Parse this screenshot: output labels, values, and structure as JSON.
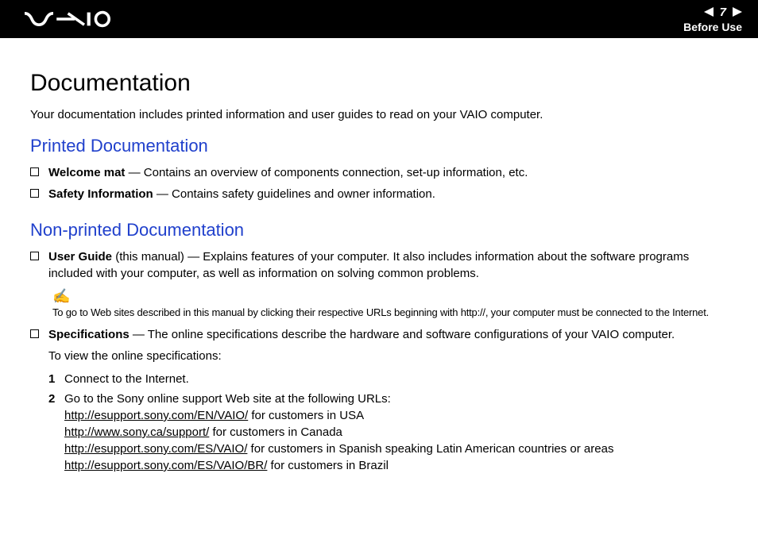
{
  "header": {
    "page_number": "7",
    "section": "Before Use"
  },
  "title": "Documentation",
  "intro": "Your documentation includes printed information and user guides to read on your VAIO computer.",
  "printed": {
    "heading": "Printed Documentation",
    "items": [
      {
        "label": "Welcome mat",
        "desc": " — Contains an overview of components connection, set-up information, etc."
      },
      {
        "label": "Safety Information",
        "desc": " — Contains safety guidelines and owner information."
      }
    ]
  },
  "nonprinted": {
    "heading": "Non-printed Documentation",
    "user_guide": {
      "label": "User Guide",
      "suffix": " (this manual) — Explains features of your computer. It also includes information about the software programs included with your computer, as well as information on solving common problems."
    },
    "note": "To go to Web sites described in this manual by clicking their respective URLs beginning with http://, your computer must be connected to the Internet.",
    "specs": {
      "label": "Specifications",
      "desc": " — The online specifications describe the hardware and software configurations of your VAIO computer.",
      "view_text": "To view the online specifications:",
      "step1": "Connect to the Internet.",
      "step2_intro": "Go to the Sony online support Web site at the following URLs:",
      "urls": [
        {
          "href": "http://esupport.sony.com/EN/VAIO/",
          "suffix": " for customers in USA"
        },
        {
          "href": "http://www.sony.ca/support/",
          "suffix": " for customers in Canada"
        },
        {
          "href": "http://esupport.sony.com/ES/VAIO/",
          "suffix": " for customers in Spanish speaking Latin American countries or areas"
        },
        {
          "href": "http://esupport.sony.com/ES/VAIO/BR/",
          "suffix": " for customers in Brazil"
        }
      ]
    }
  }
}
